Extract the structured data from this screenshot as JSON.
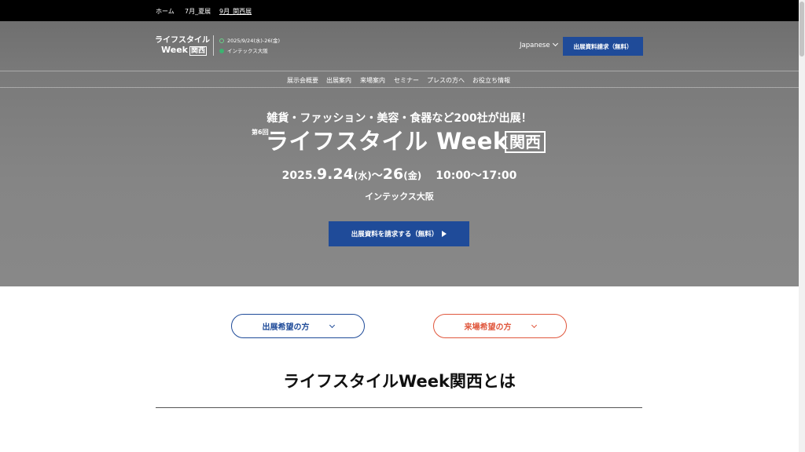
{
  "topbar": {
    "links": [
      "ホーム",
      "7月_夏展",
      "9月_関西展"
    ]
  },
  "header": {
    "logo_line1": "ライフスタイル",
    "logo_line2": "Week",
    "logo_box": "関西",
    "event_date": "2025/9/24(水)-26(金)",
    "event_venue": "インテックス大阪",
    "language": "Japanese",
    "cta_label": "出展資料請求（無料）"
  },
  "nav": {
    "items": [
      "展示会概要",
      "出展案内",
      "来場案内",
      "セミナー",
      "プレスの方へ",
      "お役立ち情報"
    ]
  },
  "hero": {
    "subtitle": "雑貨・ファッション・美容・食器など200社が出展！",
    "edition": "第6回",
    "title": "ライフスタイル Week",
    "title_box": "関西",
    "date_prefix": "2025.",
    "date_main": "9.24",
    "date_wd1": "(水)",
    "date_tilde": "〜",
    "date_end": "26",
    "date_wd2": "(金)",
    "time": "10:00〜17:00",
    "venue": "インテックス大阪",
    "cta_label": "出展資料を請求する（無料）"
  },
  "pills": {
    "exhibit_label": "出展希望の方",
    "visit_label": "来場希望の方"
  },
  "about": {
    "title": "ライフスタイルWeek関西とは"
  },
  "colors": {
    "brand_blue": "#1f4b99",
    "accent_orange": "#e0573d",
    "hero_gray": "#858585"
  }
}
